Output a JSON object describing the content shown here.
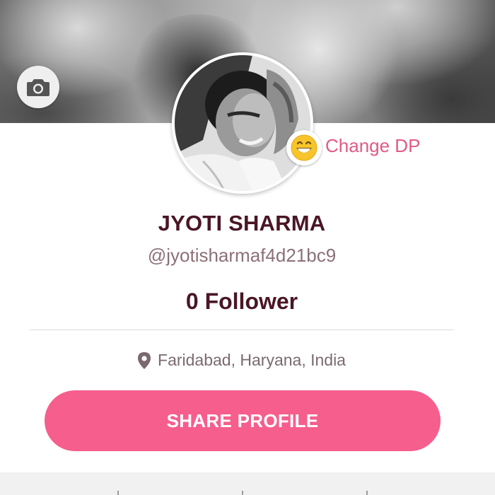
{
  "cover": {
    "camera_icon": "camera-icon"
  },
  "profile": {
    "change_dp_emoji": "grinning-face-icon",
    "change_dp_label": "Change DP",
    "name": "JYOTI SHARMA",
    "handle": "@jyotisharmaf4d21bc9",
    "followers": "0 Follower",
    "location_icon": "location-pin-icon",
    "location": "Faridabad, Haryana, India"
  },
  "actions": {
    "share_label": "SHARE PROFILE"
  },
  "colors": {
    "accent_pink": "#f65e8d",
    "change_dp_pink": "#e25a83",
    "name_maroon": "#4a1625",
    "muted_text": "#8c7077"
  }
}
